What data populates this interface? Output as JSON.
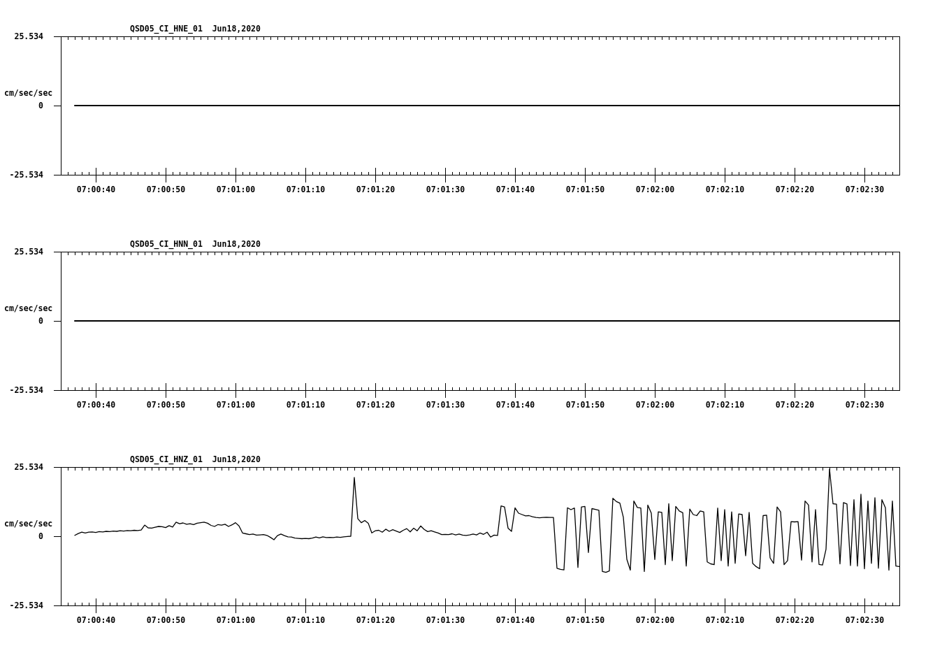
{
  "panels": [
    {
      "chart_data": {
        "type": "line",
        "title": "QSD05_CI_HNE_01  Jun18,2020",
        "ylabel": "cm/sec/sec",
        "categories": [
          null,
          null,
          null,
          null,
          null,
          "07:00:40",
          null,
          null,
          null,
          null,
          null,
          null,
          null,
          null,
          null,
          "07:00:50",
          null,
          null,
          null,
          null,
          null,
          null,
          null,
          null,
          null,
          "07:01:00",
          null,
          null,
          null,
          null,
          null,
          null,
          null,
          null,
          null,
          "07:01:10",
          null,
          null,
          null,
          null,
          null,
          null,
          null,
          null,
          null,
          "07:01:20",
          null,
          null,
          null,
          null,
          null,
          null,
          null,
          null,
          null,
          "07:01:30",
          null,
          null,
          null,
          null,
          null,
          null,
          null,
          null,
          null,
          "07:01:40",
          null,
          null,
          null,
          null,
          null,
          null,
          null,
          null,
          null,
          "07:01:50",
          null,
          null,
          null,
          null,
          null,
          null,
          null,
          null,
          null,
          "07:02:00",
          null,
          null,
          null,
          null,
          null,
          null,
          null,
          null,
          null,
          "07:02:10",
          null,
          null,
          null,
          null,
          null,
          null,
          null,
          null,
          null,
          "07:02:20",
          null,
          null,
          null,
          null,
          null,
          null,
          null,
          null,
          null,
          "07:02:30",
          null,
          null,
          null,
          null,
          null
        ],
        "series": [
          {
            "color": "#000000",
            "values": [
              null,
              null,
              0,
              0,
              0,
              0,
              0,
              0,
              0,
              0,
              0,
              0,
              0,
              0,
              0,
              0,
              0,
              0,
              0,
              0,
              0,
              0,
              0,
              0,
              0,
              0,
              0,
              0,
              0,
              0,
              0,
              0,
              0,
              0,
              0,
              0,
              0,
              0,
              0,
              0,
              0,
              0,
              0,
              0,
              0,
              0,
              0,
              0,
              0,
              0,
              0,
              0,
              0,
              0,
              0,
              0,
              0,
              0,
              0,
              0,
              0,
              0,
              0,
              0,
              0,
              0,
              0,
              0,
              0,
              0,
              0,
              0,
              0,
              0,
              0,
              0,
              0,
              0,
              0,
              0,
              0,
              0,
              0,
              0,
              0,
              0,
              0,
              0,
              0,
              0,
              0,
              0,
              0,
              0,
              0,
              0,
              0,
              0,
              0,
              0,
              0,
              0,
              0,
              0,
              0,
              0,
              0,
              0,
              0,
              0,
              0,
              0,
              0,
              0,
              0,
              0,
              0,
              0,
              0,
              0,
              0
            ]
          }
        ],
        "ylim": [
          -25.534,
          25.534
        ],
        "yticks": [
          {
            "value": 25.534,
            "label": "25.534"
          },
          {
            "value": 0,
            "label": "0"
          },
          {
            "value": -25.534,
            "label": "-25.534"
          }
        ]
      }
    },
    {
      "chart_data": {
        "type": "line",
        "title": "QSD05_CI_HNN_01  Jun18,2020",
        "ylabel": "cm/sec/sec",
        "categories": [
          null,
          null,
          null,
          null,
          null,
          "07:00:40",
          null,
          null,
          null,
          null,
          null,
          null,
          null,
          null,
          null,
          "07:00:50",
          null,
          null,
          null,
          null,
          null,
          null,
          null,
          null,
          null,
          "07:01:00",
          null,
          null,
          null,
          null,
          null,
          null,
          null,
          null,
          null,
          "07:01:10",
          null,
          null,
          null,
          null,
          null,
          null,
          null,
          null,
          null,
          "07:01:20",
          null,
          null,
          null,
          null,
          null,
          null,
          null,
          null,
          null,
          "07:01:30",
          null,
          null,
          null,
          null,
          null,
          null,
          null,
          null,
          null,
          "07:01:40",
          null,
          null,
          null,
          null,
          null,
          null,
          null,
          null,
          null,
          "07:01:50",
          null,
          null,
          null,
          null,
          null,
          null,
          null,
          null,
          null,
          "07:02:00",
          null,
          null,
          null,
          null,
          null,
          null,
          null,
          null,
          null,
          "07:02:10",
          null,
          null,
          null,
          null,
          null,
          null,
          null,
          null,
          null,
          "07:02:20",
          null,
          null,
          null,
          null,
          null,
          null,
          null,
          null,
          null,
          "07:02:30",
          null,
          null,
          null,
          null,
          null
        ],
        "series": [
          {
            "color": "#000000",
            "values": [
              null,
              null,
              0,
              0,
              0,
              0,
              0,
              0,
              0,
              0,
              0,
              0,
              0,
              0,
              0,
              0,
              0,
              0,
              0,
              0,
              0,
              0,
              0,
              0,
              0,
              0,
              0,
              0,
              0,
              0,
              0,
              0,
              0,
              0,
              0,
              0,
              0,
              0,
              0,
              0,
              0,
              0,
              0,
              0,
              0,
              0,
              0,
              0,
              0,
              0,
              0,
              0,
              0,
              0,
              0,
              0,
              0,
              0,
              0,
              0,
              0,
              0,
              0,
              0,
              0,
              0,
              0,
              0,
              0,
              0,
              0,
              0,
              0,
              0,
              0,
              0,
              0,
              0,
              0,
              0,
              0,
              0,
              0,
              0,
              0,
              0,
              0,
              0,
              0,
              0,
              0,
              0,
              0,
              0,
              0,
              0,
              0,
              0,
              0,
              0,
              0,
              0,
              0,
              0,
              0,
              0,
              0,
              0,
              0,
              0,
              0,
              0,
              0,
              0,
              0,
              0,
              0,
              0,
              0,
              0,
              0
            ]
          }
        ],
        "ylim": [
          -25.534,
          25.534
        ],
        "yticks": [
          {
            "value": 25.534,
            "label": "25.534"
          },
          {
            "value": 0,
            "label": "0"
          },
          {
            "value": -25.534,
            "label": "-25.534"
          }
        ]
      }
    },
    {
      "chart_data": {
        "type": "line",
        "title": "QSD05_CI_HNZ_01  Jun18,2020",
        "ylabel": "cm/sec/sec",
        "categories": [
          null,
          null,
          null,
          null,
          null,
          null,
          null,
          null,
          null,
          null,
          "07:00:40",
          null,
          null,
          null,
          null,
          null,
          null,
          null,
          null,
          null,
          null,
          null,
          null,
          null,
          null,
          null,
          null,
          null,
          null,
          null,
          "07:00:50",
          null,
          null,
          null,
          null,
          null,
          null,
          null,
          null,
          null,
          null,
          null,
          null,
          null,
          null,
          null,
          null,
          null,
          null,
          null,
          "07:01:00",
          null,
          null,
          null,
          null,
          null,
          null,
          null,
          null,
          null,
          null,
          null,
          null,
          null,
          null,
          null,
          null,
          null,
          null,
          null,
          "07:01:10",
          null,
          null,
          null,
          null,
          null,
          null,
          null,
          null,
          null,
          null,
          null,
          null,
          null,
          null,
          null,
          null,
          null,
          null,
          null,
          "07:01:20",
          null,
          null,
          null,
          null,
          null,
          null,
          null,
          null,
          null,
          null,
          null,
          null,
          null,
          null,
          null,
          null,
          null,
          null,
          null,
          "07:01:30",
          null,
          null,
          null,
          null,
          null,
          null,
          null,
          null,
          null,
          null,
          null,
          null,
          null,
          null,
          null,
          null,
          null,
          null,
          null,
          "07:01:40",
          null,
          null,
          null,
          null,
          null,
          null,
          null,
          null,
          null,
          null,
          null,
          null,
          null,
          null,
          null,
          null,
          null,
          null,
          null,
          "07:01:50",
          null,
          null,
          null,
          null,
          null,
          null,
          null,
          null,
          null,
          null,
          null,
          null,
          null,
          null,
          null,
          null,
          null,
          null,
          null,
          "07:02:00",
          null,
          null,
          null,
          null,
          null,
          null,
          null,
          null,
          null,
          null,
          null,
          null,
          null,
          null,
          null,
          null,
          null,
          null,
          null,
          "07:02:10",
          null,
          null,
          null,
          null,
          null,
          null,
          null,
          null,
          null,
          null,
          null,
          null,
          null,
          null,
          null,
          null,
          null,
          null,
          null,
          "07:02:20",
          null,
          null,
          null,
          null,
          null,
          null,
          null,
          null,
          null,
          null,
          null,
          null,
          null,
          null,
          null,
          null,
          null,
          null,
          null,
          "07:02:30",
          null,
          null,
          null,
          null,
          null,
          null,
          null,
          null,
          null,
          null
        ],
        "series": [
          {
            "color": "#000000",
            "values": [
              null,
              null,
              null,
              null,
              0.3,
              1.0,
              1.5,
              1.2,
              1.5,
              1.6,
              1.4,
              1.7,
              1.6,
              1.8,
              1.7,
              1.9,
              1.8,
              2.0,
              1.9,
              2.1,
              2.0,
              2.2,
              2.1,
              2.3,
              4.1,
              3.1,
              3.0,
              3.3,
              3.6,
              3.5,
              3.2,
              3.9,
              3.4,
              5.2,
              4.6,
              4.9,
              4.4,
              4.6,
              4.3,
              4.8,
              5.0,
              5.2,
              4.8,
              4.0,
              3.6,
              4.3,
              4.1,
              4.4,
              3.6,
              4.2,
              5.0,
              3.8,
              1.2,
              0.9,
              0.6,
              0.8,
              0.4,
              0.5,
              0.6,
              0.3,
              -0.4,
              -1.3,
              0.2,
              0.8,
              0.2,
              -0.2,
              -0.3,
              -0.7,
              -0.8,
              -0.9,
              -0.8,
              -0.9,
              -0.7,
              -0.3,
              -0.6,
              -0.2,
              -0.5,
              -0.4,
              -0.5,
              -0.3,
              -0.4,
              -0.2,
              -0.1,
              0.0,
              21.7,
              6.5,
              5.0,
              5.8,
              4.8,
              1.2,
              2.0,
              2.2,
              1.5,
              2.6,
              1.8,
              2.4,
              1.9,
              1.4,
              2.2,
              2.8,
              1.6,
              3.0,
              2.0,
              3.8,
              2.5,
              1.7,
              2.0,
              1.6,
              1.2,
              0.6,
              0.7,
              0.6,
              0.9,
              0.5,
              0.8,
              0.4,
              0.3,
              0.5,
              0.8,
              0.5,
              1.2,
              0.7,
              1.5,
              -0.3,
              0.4,
              0.3,
              11.2,
              10.8,
              3.0,
              1.8,
              10.5,
              8.5,
              8.0,
              7.5,
              7.6,
              7.2,
              6.9,
              6.8,
              6.9,
              7.0,
              6.9,
              6.9,
              -11.8,
              -12.2,
              -12.4,
              10.5,
              9.8,
              10.4,
              -11.5,
              10.8,
              11.0,
              -6.0,
              10.2,
              9.9,
              9.6,
              -13.0,
              -13.3,
              -12.8,
              14.0,
              12.8,
              12.2,
              7.0,
              -8.5,
              -12.5,
              13.0,
              10.6,
              10.4,
              -13.0,
              11.5,
              8.5,
              -8.6,
              9.0,
              8.8,
              -10.5,
              12.0,
              -9.0,
              11.0,
              9.3,
              8.7,
              -11.0,
              10.0,
              8.0,
              7.6,
              9.3,
              9.0,
              -9.5,
              -10.2,
              -10.5,
              10.4,
              -9.0,
              9.8,
              -11.0,
              9.0,
              -10.0,
              8.2,
              8.0,
              -7.2,
              8.8,
              -10.0,
              -11.2,
              -12.0,
              7.6,
              7.8,
              -8.0,
              -10.0,
              10.8,
              9.0,
              -10.5,
              -9.0,
              5.4,
              5.3,
              5.4,
              -8.8,
              13.0,
              11.5,
              -9.5,
              9.8,
              -10.4,
              -10.6,
              -4.8,
              24.8,
              12.0,
              11.8,
              -10.2,
              12.4,
              11.9,
              -10.8,
              13.5,
              -11.0,
              15.5,
              -12.0,
              13.0,
              -10.0,
              14.2,
              -11.8,
              13.5,
              10.5,
              -12.5,
              13.0,
              -11.0,
              -11.2
            ]
          }
        ],
        "ylim": [
          -25.534,
          25.534
        ],
        "yticks": [
          {
            "value": 25.534,
            "label": "25.534"
          },
          {
            "value": 0,
            "label": "0"
          },
          {
            "value": -25.534,
            "label": "-25.534"
          }
        ]
      }
    }
  ]
}
